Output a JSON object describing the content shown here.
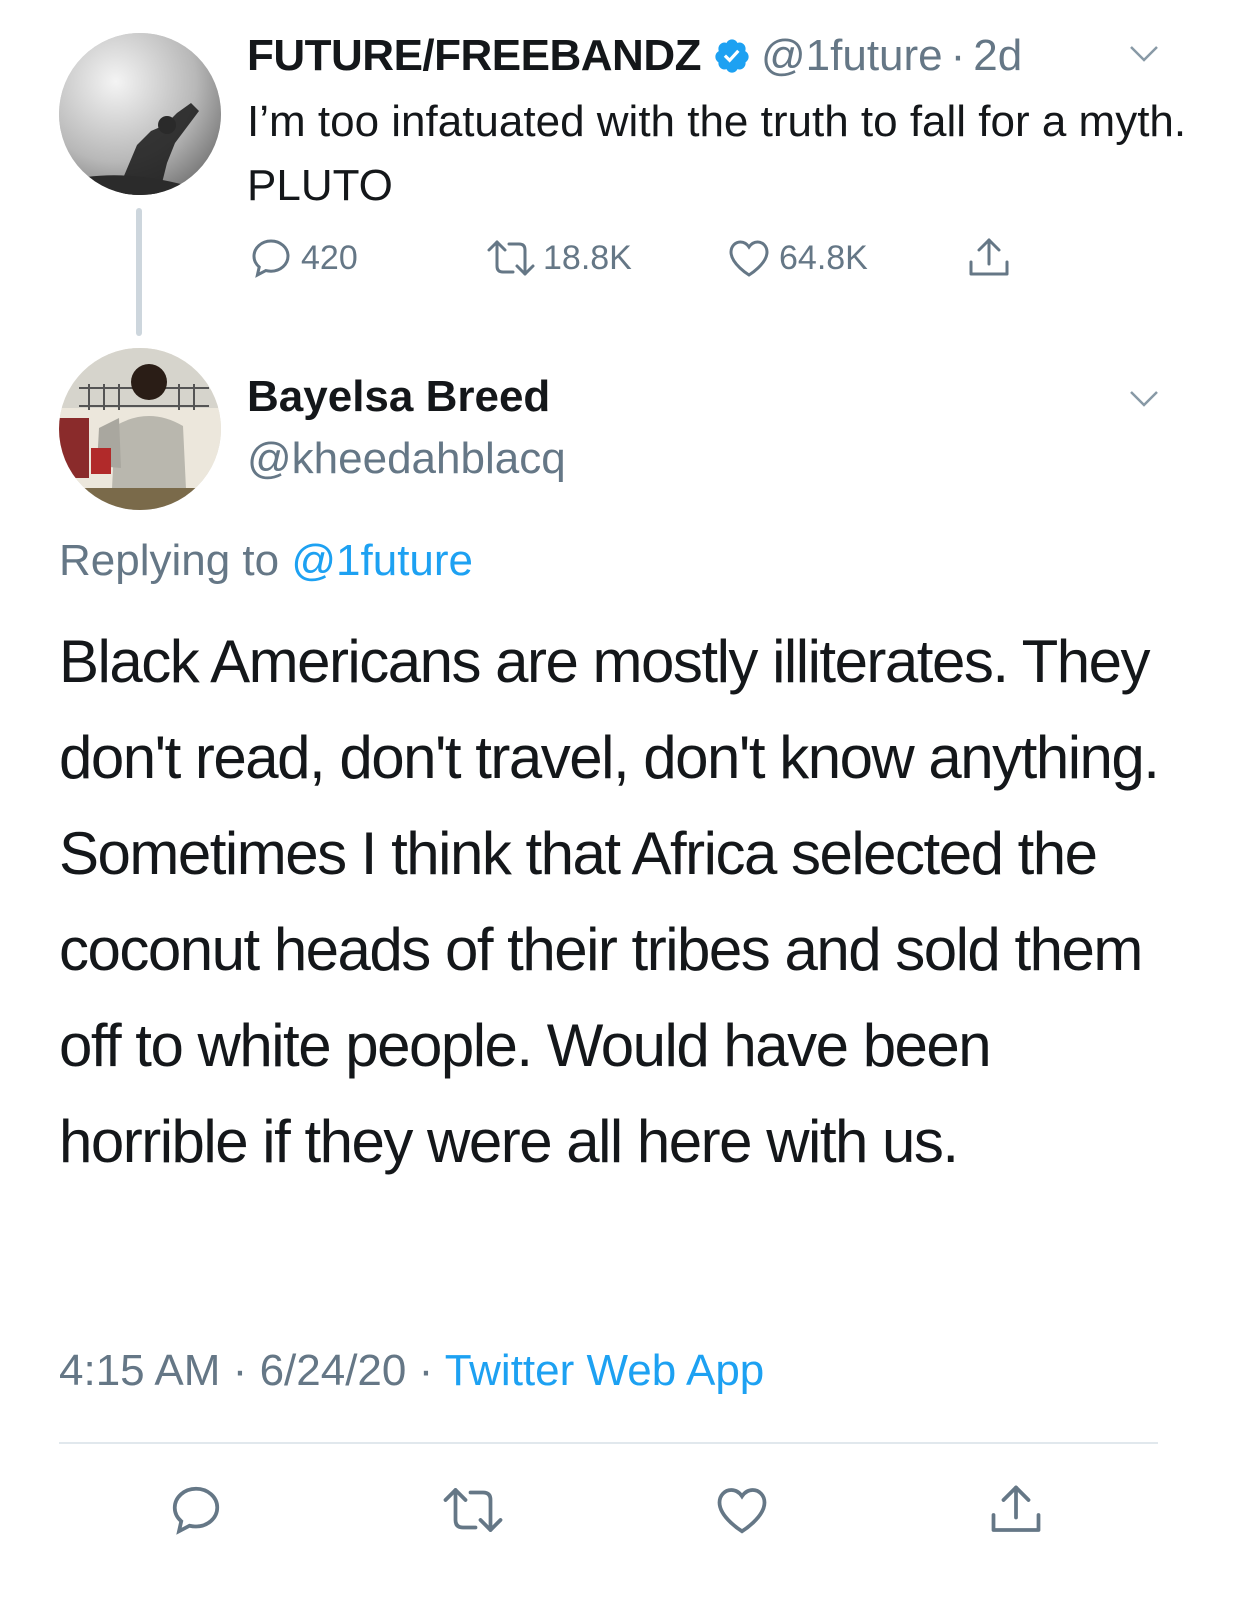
{
  "parent_tweet": {
    "display_name": "FUTURE/FREEBANDZ",
    "handle": "@1future",
    "separator": "·",
    "time": "2d",
    "text": "I’m too infatuated with the truth to fall for a myth. PLUTO",
    "replies": "420",
    "retweets": "18.8K",
    "likes": "64.8K"
  },
  "reply_tweet": {
    "display_name": "Bayelsa Breed",
    "handle": "@kheedahblacq",
    "replying_prefix": "Replying to",
    "replying_mention": "@1future",
    "text": "Black Americans are mostly illiterates. They don't read, don't travel, don't know anything. Sometimes I think that Africa selected the coconut heads of their tribes and sold them off to white people. Would have been horrible if they were all here with us.",
    "time": "4:15 AM",
    "date": "6/24/20",
    "separator": "·",
    "source": "Twitter Web App"
  },
  "icons": {
    "verified": "verified-badge-icon",
    "menu": "chevron-down-icon",
    "reply": "reply-icon",
    "retweet": "retweet-icon",
    "like": "like-icon",
    "share": "share-icon"
  },
  "colors": {
    "accent": "#1da1f2",
    "secondary_text": "#657786",
    "primary_text": "#14171a",
    "divider": "#e1e8ed",
    "thread_line": "#cdd6dd"
  }
}
